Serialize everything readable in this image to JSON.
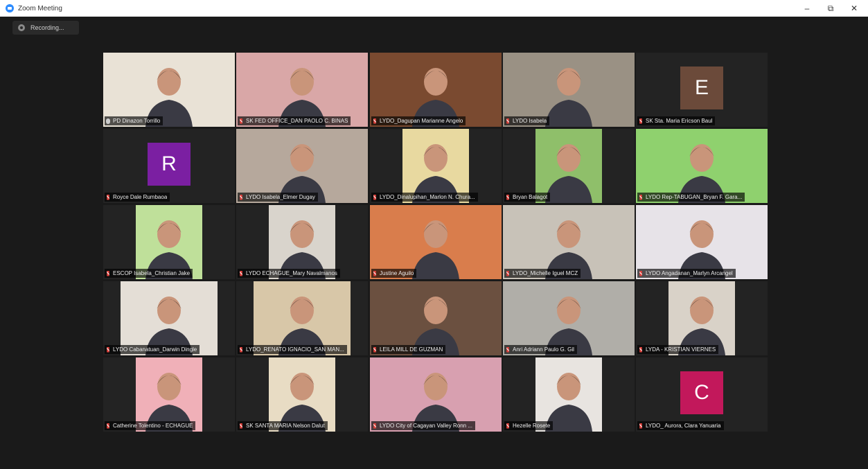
{
  "window": {
    "title": "Zoom Meeting",
    "controls": {
      "minimize": "–",
      "maximize": "⧉",
      "close": "✕"
    }
  },
  "recording": {
    "label": "Recording..."
  },
  "colors": {
    "active_speaker_outline": "#d6e43a",
    "muted_mic": "#e0413b",
    "avatar_E": "#6b4a3a",
    "avatar_R": "#7b1fa2",
    "avatar_C": "#c2185b"
  },
  "participants": [
    {
      "name": "PD Dinazon Torrillo",
      "mic": "on",
      "active": true,
      "type": "video",
      "bg": "#e9e2d6"
    },
    {
      "name": "SK FED OFFICE_DAN PAOLO C. BINAS",
      "mic": "muted",
      "type": "video",
      "bg": "#d9a7a7"
    },
    {
      "name": "LYDO_Dagupan Marianne Angelo",
      "mic": "muted",
      "type": "video",
      "bg": "#7a4a30"
    },
    {
      "name": "LYDO Isabela",
      "mic": "muted",
      "type": "video",
      "bg": "#9a9184"
    },
    {
      "name": "SK Sta. Maria Ericson Baul",
      "mic": "muted",
      "type": "avatar",
      "initial": "E",
      "color": "#6b4a3a"
    },
    {
      "name": "Royce Dale Rumbaoa",
      "mic": "muted",
      "type": "avatar",
      "initial": "R",
      "color": "#7b1fa2"
    },
    {
      "name": "LYDO Isabela_Elmer Dugay",
      "mic": "muted",
      "type": "video",
      "bg": "#b6a89c"
    },
    {
      "name": "LYDO_Dinalupihan_Marlon N. Chura...",
      "mic": "muted",
      "type": "video",
      "bg": "#e8d9a0"
    },
    {
      "name": "Bryan Balagot",
      "mic": "muted",
      "type": "video",
      "bg": "#8fbf6a"
    },
    {
      "name": "LYDO Rep-TABUGAN_Bryan F. Gara...",
      "mic": "muted",
      "type": "video",
      "bg": "#8fd16e"
    },
    {
      "name": "ESCOP Isabela_Christian Jake",
      "mic": "muted",
      "type": "video",
      "bg": "#bfe09a"
    },
    {
      "name": "LYDO ECHAGUE_Mary Navalmanos",
      "mic": "muted",
      "type": "video",
      "bg": "#d9d4cc"
    },
    {
      "name": "Justine Aguilo",
      "mic": "muted",
      "type": "video",
      "bg": "#d97d4c"
    },
    {
      "name": "LYDO_Michelle Iguel MCZ",
      "mic": "muted",
      "type": "video",
      "bg": "#c8c2b8"
    },
    {
      "name": "LYDO Angadanan_Marlyn Arcangel",
      "mic": "muted",
      "type": "video",
      "bg": "#e7e3e8"
    },
    {
      "name": "LYDO Cabanatuan_Darwin Dingle",
      "mic": "muted",
      "type": "video",
      "bg": "#e4ded6"
    },
    {
      "name": "LYDO_RENATO IGNACIO_SAN MAN...",
      "mic": "muted",
      "type": "video",
      "bg": "#d8c7a8"
    },
    {
      "name": "LEILA MILL DE GUZMAN",
      "mic": "muted",
      "type": "video",
      "bg": "#6b5040"
    },
    {
      "name": "Anri Adriann Paulo G. Gil",
      "mic": "muted",
      "type": "video",
      "bg": "#b0aea8"
    },
    {
      "name": "LYDA - KRISTIAN VIERNES",
      "mic": "muted",
      "type": "video",
      "bg": "#d9d2c8"
    },
    {
      "name": "Catherine Tolentino - ECHAGUE",
      "mic": "muted",
      "type": "video",
      "bg": "#f0b0b8"
    },
    {
      "name": "SK SANTA MARIA Nelson Dalut",
      "mic": "muted",
      "type": "video",
      "bg": "#e8dcc4"
    },
    {
      "name": "LYDO City of Cagayan Valley Ronn ...",
      "mic": "muted",
      "type": "video",
      "bg": "#d8a0b0"
    },
    {
      "name": "Hezelle Rosete",
      "mic": "muted",
      "type": "video",
      "bg": "#e8e4e0"
    },
    {
      "name": "LYDO_ Aurora, Clara Yanuaria",
      "mic": "muted",
      "type": "avatar",
      "initial": "C",
      "color": "#c2185b"
    }
  ]
}
